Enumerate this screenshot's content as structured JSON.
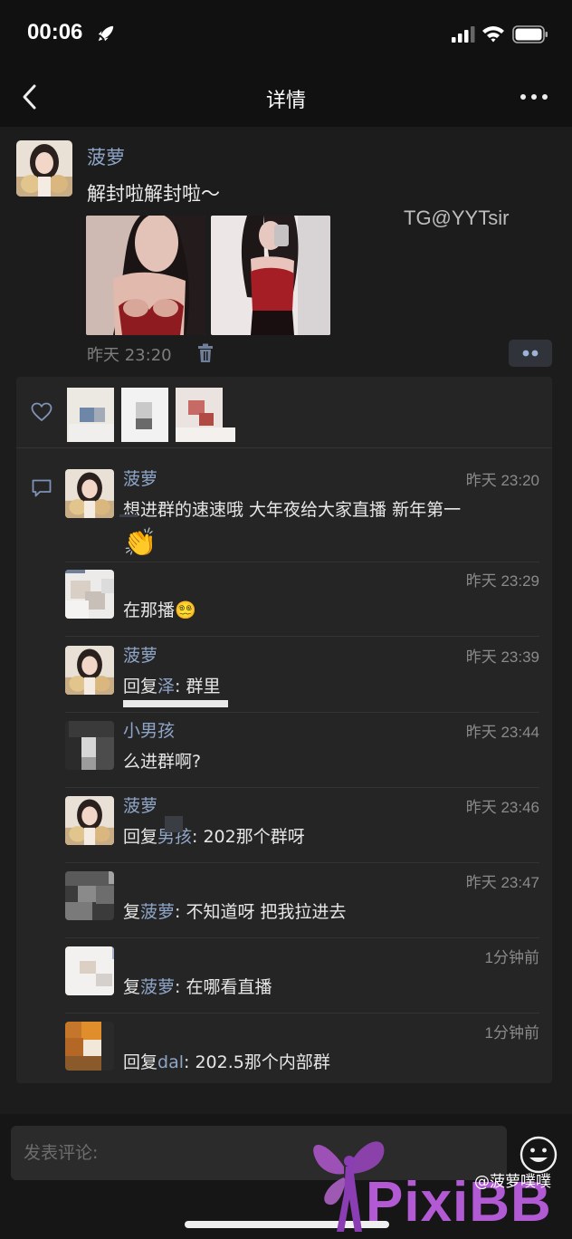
{
  "status_bar": {
    "time": "00:06"
  },
  "nav": {
    "title": "详情"
  },
  "post": {
    "author": "菠萝",
    "text": "解封啦解封啦～",
    "overlay_watermark": "TG@YYTsir",
    "time": "昨天 23:20"
  },
  "comments": [
    {
      "name": "菠萝",
      "time": "昨天 23:20",
      "text": "想进群的速速哦  大年夜给大家直播 新年第一",
      "emoji": "👏"
    },
    {
      "name": "",
      "time": "昨天 23:29",
      "text": "在那播",
      "emoji": "😵‍💫"
    },
    {
      "name": "菠萝",
      "time": "昨天 23:39",
      "prefix": "回复",
      "target": "泽",
      "text": ": 群里"
    },
    {
      "name": "小男孩",
      "time": "昨天 23:44",
      "text": "么进群啊?"
    },
    {
      "name": "菠萝",
      "time": "昨天 23:46",
      "prefix": "回复",
      "target": "男孩",
      "text": ": 202那个群呀"
    },
    {
      "name": "",
      "time": "昨天 23:47",
      "prefix": "复",
      "target": "菠萝",
      "text": ": 不知道呀 把我拉进去"
    },
    {
      "name": "",
      "time": "1分钟前",
      "prefix": "复",
      "target": "菠萝",
      "text": ": 在哪看直播"
    },
    {
      "name": "",
      "time": "1分钟前",
      "prefix": "回复",
      "target": "dal",
      "text": ": 202.5那个内部群"
    }
  ],
  "composer": {
    "placeholder": "发表评论:"
  },
  "watermarks": {
    "handle": "@菠萝噗噗",
    "site": "PixiBB"
  },
  "colors": {
    "name_link": "#8fa5c8",
    "background": "#1c1c1c",
    "panel": "#252525",
    "watermark": "#b259d4"
  }
}
